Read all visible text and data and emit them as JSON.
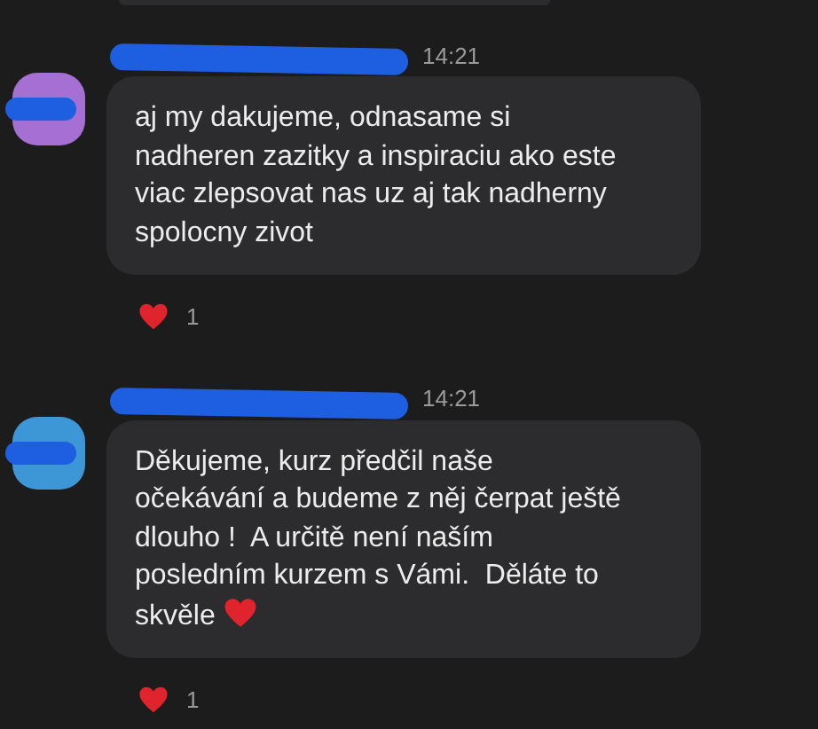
{
  "messages": [
    {
      "time": "14:21",
      "color": "#a56fd3",
      "text": "aj my dakujeme, odnasame si\nnadheren zazitky a inspiraciu ako este\nviac zlepsovat nas uz aj tak nadherny\nspolocny zivot",
      "reaction_count": "1"
    },
    {
      "time": "14:21",
      "color": "#3d97d6",
      "text": "Děkujeme, kurz předčil naše\nočekávání a budeme z něj čerpat ještě\ndlouho !  A určitě není naším\nposledním kurzem s Vámi.  Děláte to\nskvěle",
      "ends_with_heart": true,
      "reaction_count": "1"
    }
  ]
}
